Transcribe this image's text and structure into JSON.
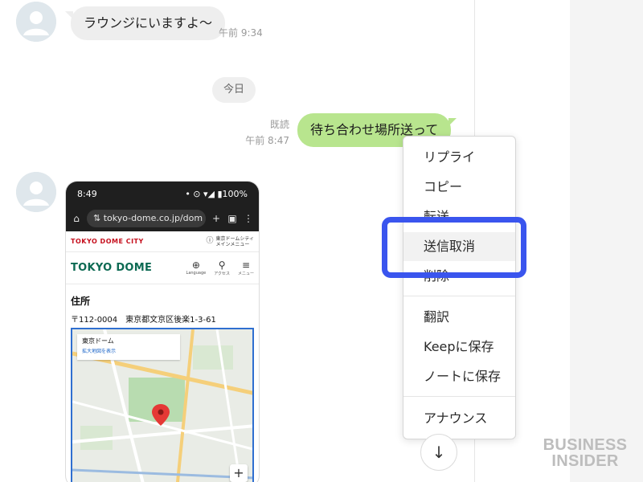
{
  "messages": {
    "incoming_1": {
      "text": "ラウンジにいますよ〜",
      "time": "午前 9:34"
    },
    "date_separator": "今日",
    "outgoing_1": {
      "text": "待ち合わせ場所送って",
      "read_status": "既読",
      "time": "午前 8:47"
    }
  },
  "screenshot": {
    "status_time": "8:49",
    "status_right": "• ⊙ ▾◢ ▮100%",
    "url": "tokyo-dome.co.jp/dom",
    "site_brand": "TOKYO DOME CITY",
    "site_menu_line1": "東京ドームシティ",
    "site_menu_line2": "メインメニュー",
    "logo": "TOKYO DOME",
    "nav": {
      "language": "Language",
      "access": "アクセス",
      "menu": "メニュー"
    },
    "address_title": "住所",
    "address": "〒112-0004　東京都文京区後楽1-3-61",
    "map_card_title": "東京ドーム",
    "map_card_link": "拡大地図を表示",
    "map_zoom": "+"
  },
  "context_menu": {
    "items": [
      "リプライ",
      "コピー",
      "転送",
      "送信取消",
      "削除",
      "翻訳",
      "Keepに保存",
      "ノートに保存",
      "アナウンス"
    ]
  },
  "scroll_button": "↓",
  "watermark": {
    "line1": "BUSINESS",
    "line2": "INSIDER"
  },
  "colors": {
    "outgoing_bubble": "#b8e58e",
    "incoming_bubble": "#eeeeee",
    "highlight_border": "#3a55ee",
    "logo_green": "#0d6a53"
  },
  "icons": {
    "avatar": "person-avatar-icon",
    "home": "home-icon",
    "site_settings": "tune-icon",
    "new_tab": "plus-icon",
    "tabs": "tab-count-icon",
    "more": "more-vert-icon",
    "map_pin": "map-pin-icon",
    "scroll_down": "arrow-down-icon"
  }
}
